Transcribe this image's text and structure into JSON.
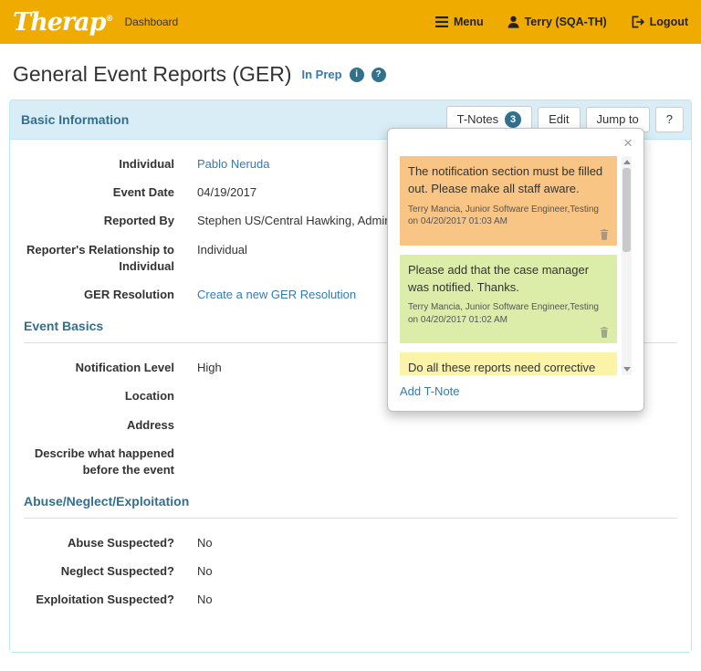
{
  "topbar": {
    "brand": "Therap",
    "registered": "®",
    "dashboard_label": "Dashboard",
    "menu_label": "Menu",
    "user_label": "Terry (SQA-TH)",
    "logout_label": "Logout"
  },
  "page": {
    "title": "General Event Reports (GER)",
    "status_label": "In Prep",
    "info_icon": "i",
    "help_icon": "?"
  },
  "panel": {
    "title": "Basic Information",
    "tnotes_label": "T-Notes",
    "tnotes_count": "3",
    "edit_label": "Edit",
    "jumpto_label": "Jump to",
    "help_label": "?"
  },
  "basic_info": {
    "fields": [
      {
        "label": "Individual",
        "value": "Pablo Neruda"
      },
      {
        "label": "Event Date",
        "value": "04/19/2017"
      },
      {
        "label": "Reported By",
        "value": "Stephen US/Central Hawking, Admin"
      },
      {
        "label": "Reporter's Relationship to Individual",
        "value": "Individual"
      },
      {
        "label": "GER Resolution",
        "value": "Create a new GER Resolution"
      }
    ]
  },
  "event_basics": {
    "title": "Event Basics",
    "fields": [
      {
        "label": "Notification Level",
        "value": "High"
      },
      {
        "label": "Location",
        "value": ""
      },
      {
        "label": "Address",
        "value": ""
      },
      {
        "label": "Describe what happened before the event",
        "value": ""
      }
    ]
  },
  "abuse_section": {
    "title": "Abuse/Neglect/Exploitation",
    "fields": [
      {
        "label": "Abuse Suspected?",
        "value": "No"
      },
      {
        "label": "Neglect Suspected?",
        "value": "No"
      },
      {
        "label": "Exploitation Suspected?",
        "value": "No"
      }
    ]
  },
  "tnotes_popover": {
    "close_label": "×",
    "add_label": "Add T-Note",
    "notes": [
      {
        "text": "The notification section must be filled out. Please make all staff aware.",
        "meta": "Terry Mancia, Junior Software Engineer,Testing on 04/20/2017 01:03 AM",
        "color": "#f8c584"
      },
      {
        "text": "Please add that the case manager was notified. Thanks.",
        "meta": "Terry Mancia, Junior Software Engineer,Testing on 04/20/2017 01:02 AM",
        "color": "#dcedaa"
      },
      {
        "text": "Do all these reports need corrective action?",
        "meta": "",
        "color": "#faf3a8"
      }
    ]
  },
  "colors": {
    "topbar_bg": "#f0ab00",
    "panel_header_bg": "#d9edf7",
    "panel_border": "#bce8f1",
    "accent_blue": "#31708f",
    "link_blue": "#337ab7"
  }
}
